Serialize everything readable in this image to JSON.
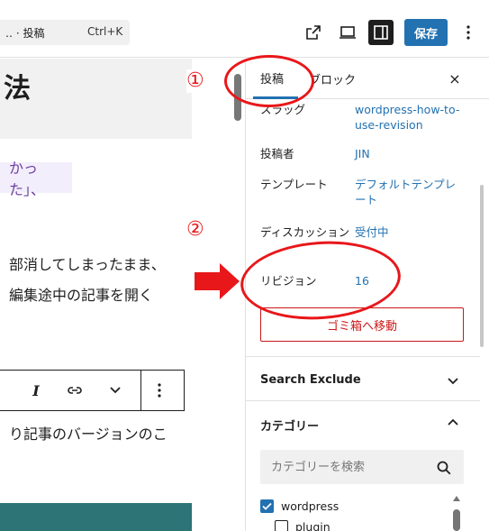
{
  "topbar": {
    "breadcrumb": "‥ · 投稿",
    "shortcut": "Ctrl+K",
    "save_label": "保存",
    "icons": [
      "external-link-icon",
      "desktop-view-icon",
      "sidebar-toggle-icon",
      "more-options-icon"
    ]
  },
  "editor": {
    "title_fragment": "法",
    "highlight_fragment": "かった」、",
    "body_lines": [
      "部消してしまったまま、",
      "編集途中の記事を開く",
      "り記事のバージョンのこ"
    ],
    "toolbar": {
      "italic_label": "I",
      "icons": [
        "italic-icon",
        "link-icon",
        "chevron-down-icon",
        "more-vertical-icon"
      ]
    }
  },
  "annotations": {
    "step1": "①",
    "step2": "②",
    "accent_color": "#e8171a"
  },
  "sidebar": {
    "tabs": [
      {
        "label": "投稿",
        "active": true
      },
      {
        "label": "ブロック",
        "active": false
      }
    ],
    "close_icon": "×",
    "rows": [
      {
        "label": "スラッグ",
        "value": "wordpress-how-to-use-revision"
      },
      {
        "label": "投稿者",
        "value": "JIN"
      },
      {
        "label": "テンプレート",
        "value": "デフォルトテンプレート"
      },
      {
        "label": "ディスカッション",
        "value": "受付中"
      },
      {
        "label": "リビジョン",
        "value": "16"
      }
    ],
    "trash_label": "ゴミ箱へ移動",
    "panels": {
      "search_exclude": "Search Exclude",
      "categories": "カテゴリー"
    },
    "category_search_placeholder": "カテゴリーを検索",
    "categories": [
      {
        "label": "wordpress",
        "checked": true
      },
      {
        "label": "plugin",
        "checked": false
      }
    ]
  },
  "colors": {
    "accent_blue": "#2271b1",
    "danger_red": "#cc1818",
    "teal_block": "#2d7477"
  }
}
